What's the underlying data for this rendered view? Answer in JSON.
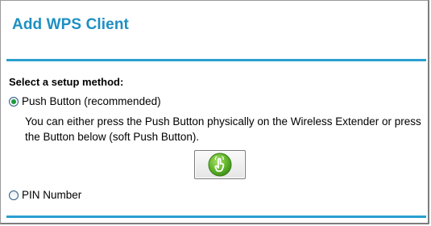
{
  "page": {
    "title": "Add WPS Client"
  },
  "setup": {
    "section_label": "Select a setup method:",
    "selected_method": "Push Button (recommended)",
    "options": [
      {
        "label": "Push Button (recommended)",
        "checked": true,
        "description": "You can either press the Push Button physically on the Wireless Extender or press the Button below (soft Push Button)."
      },
      {
        "label": "PIN Number",
        "checked": false
      }
    ],
    "soft_button_icon": "wps-push-button-icon"
  },
  "colors": {
    "title": "#1e8fc1",
    "rule": "#2a9fd0",
    "radio_dot": "#1b9a3a",
    "wps_icon_green": "#5fb52a"
  }
}
